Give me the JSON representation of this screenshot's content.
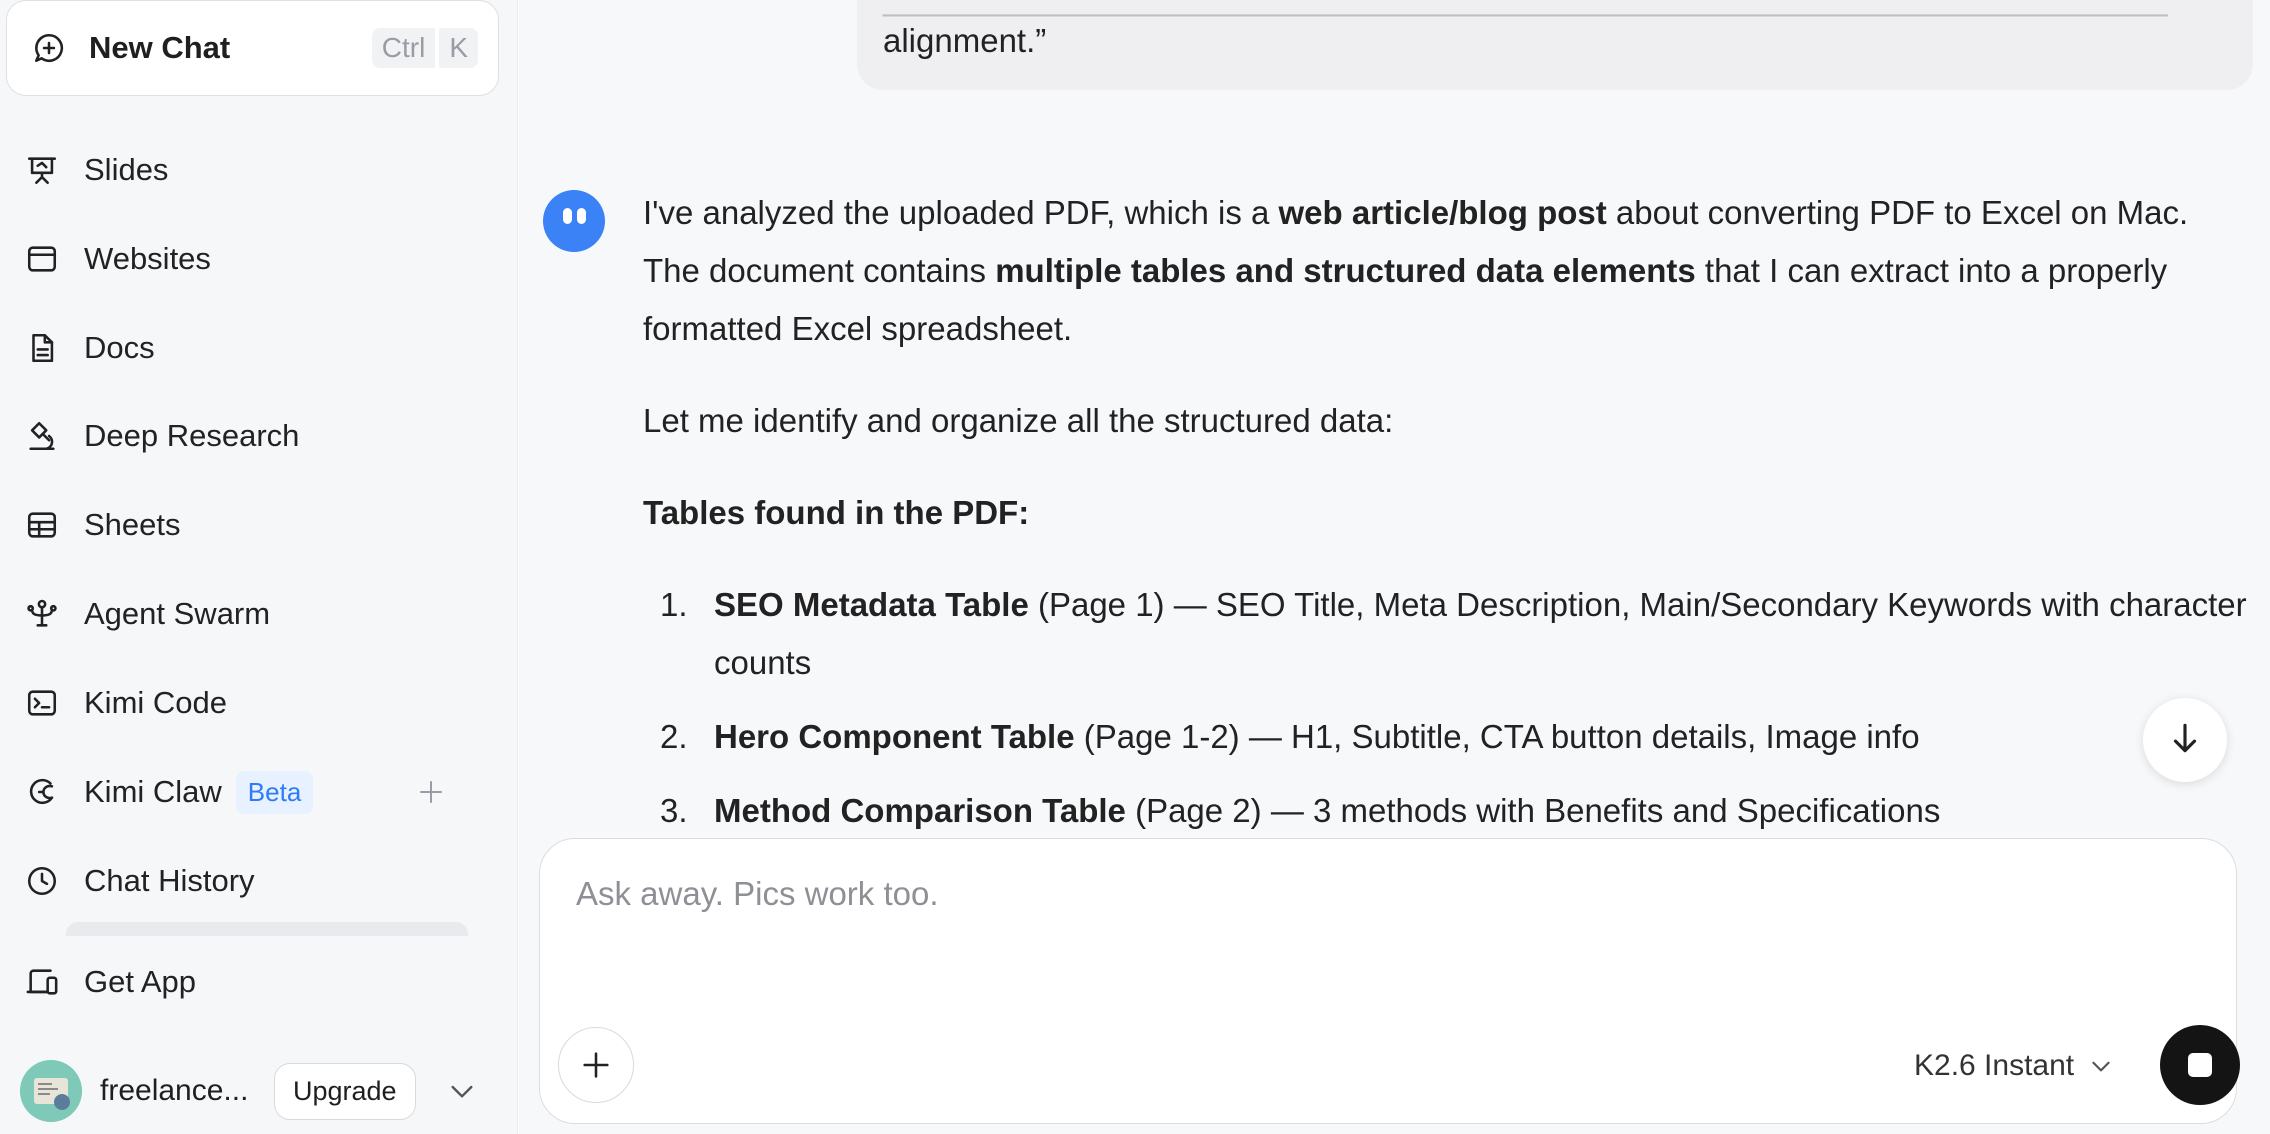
{
  "sidebar": {
    "new_chat": {
      "label": "New Chat",
      "shortcut": [
        "Ctrl",
        "K"
      ]
    },
    "items": [
      {
        "label": "Slides",
        "icon": "presentation-icon"
      },
      {
        "label": "Websites",
        "icon": "browser-window-icon"
      },
      {
        "label": "Docs",
        "icon": "document-icon"
      },
      {
        "label": "Deep Research",
        "icon": "microscope-icon"
      },
      {
        "label": "Sheets",
        "icon": "table-icon"
      },
      {
        "label": "Agent Swarm",
        "icon": "agent-network-icon"
      },
      {
        "label": "Kimi Code",
        "icon": "terminal-icon"
      },
      {
        "label": "Kimi Claw",
        "icon": "claw-icon",
        "badge": "Beta"
      },
      {
        "label": "Chat History",
        "icon": "clock-icon"
      },
      {
        "label": "Get App",
        "icon": "devices-icon"
      }
    ],
    "user": {
      "name": "freelance...",
      "upgrade_label": "Upgrade"
    }
  },
  "conversation": {
    "user_message_tail": "alignment.”",
    "assistant": {
      "p1": {
        "t1": "I've analyzed the uploaded PDF, which is a ",
        "b1": "web article/blog post",
        "t2": " about converting PDF to Excel on Mac. The document contains ",
        "b2": "multiple tables and structured data elements",
        "t3": " that I can extract into a properly formatted Excel spreadsheet."
      },
      "p2": "Let me identify and organize all the structured data:",
      "heading": "Tables found in the PDF:",
      "list": [
        {
          "num": "1.",
          "title": "SEO Metadata Table",
          "rest": " (Page 1) — SEO Title, Meta Description, Main/Secondary Keywords with character counts"
        },
        {
          "num": "2.",
          "title": "Hero Component Table",
          "rest": " (Page 1-2) — H1, Subtitle, CTA button details, Image info"
        },
        {
          "num": "3.",
          "title": "Method Comparison Table",
          "rest": " (Page 2) — 3 methods with Benefits and Specifications"
        }
      ]
    }
  },
  "composer": {
    "placeholder": "Ask away. Pics work too.",
    "model": "K2.6 Instant"
  },
  "colors": {
    "accent": "#3b82f6",
    "badge_text": "#2f7cf6",
    "badge_bg": "#e7f1ff"
  }
}
